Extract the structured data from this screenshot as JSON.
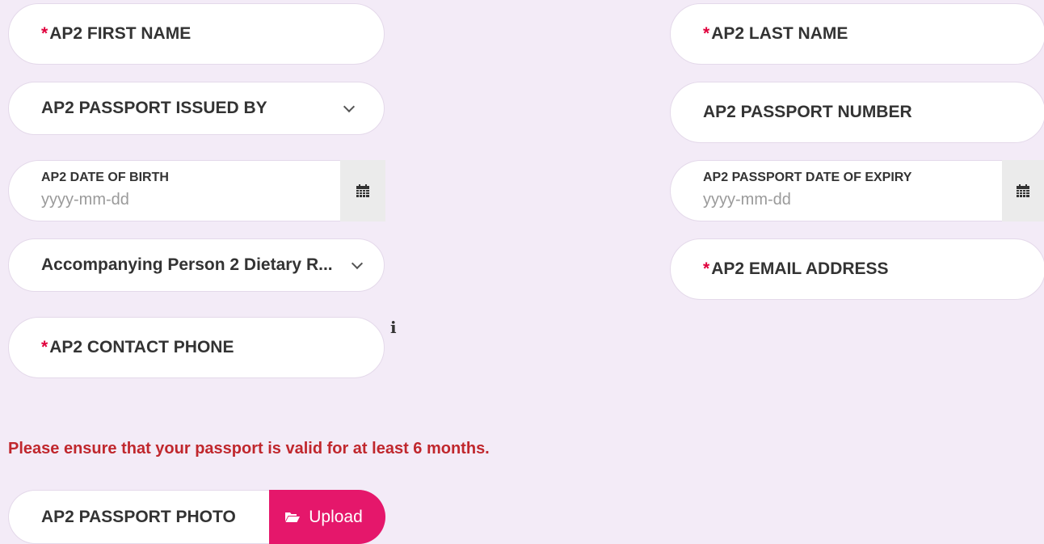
{
  "fields": {
    "first_name": {
      "label": "AP2 FIRST NAME",
      "required_mark": "*"
    },
    "last_name": {
      "label": "AP2 LAST NAME",
      "required_mark": "*"
    },
    "passport_issued_by": {
      "label": "AP2 PASSPORT ISSUED BY"
    },
    "passport_number": {
      "label": "AP2 PASSPORT NUMBER"
    },
    "date_of_birth": {
      "label": "AP2 DATE OF BIRTH",
      "placeholder": "yyyy-mm-dd"
    },
    "passport_expiry": {
      "label": "AP2 PASSPORT DATE OF EXPIRY",
      "placeholder": "yyyy-mm-dd"
    },
    "dietary": {
      "label": "Accompanying Person 2 Dietary R..."
    },
    "email": {
      "label": "AP2 EMAIL ADDRESS",
      "required_mark": "*"
    },
    "contact_phone": {
      "label": "AP2 CONTACT PHONE",
      "required_mark": "*"
    }
  },
  "info_icon": {
    "glyph": "i",
    "icon": "info-icon"
  },
  "notice": {
    "text": "Please ensure that your passport is valid for at least 6 months.",
    "color": "#c0272d"
  },
  "upload": {
    "label": "AP2 PASSPORT PHOTO",
    "button_label": "Upload",
    "button_color": "#e5176b",
    "icon": "folder-open-icon"
  },
  "colors": {
    "background": "#f3ebf7",
    "required": "#e0003c"
  }
}
